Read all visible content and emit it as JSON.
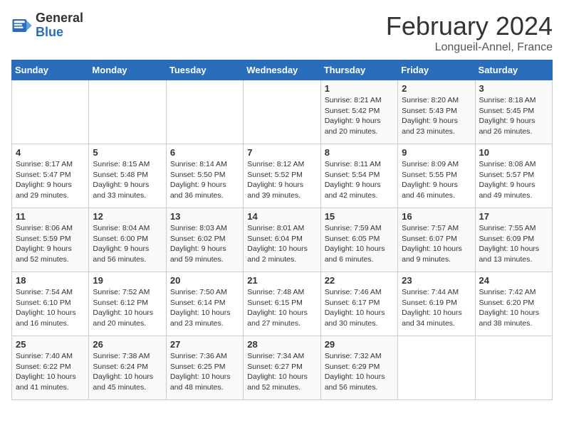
{
  "header": {
    "logo_general": "General",
    "logo_blue": "Blue",
    "title": "February 2024",
    "subtitle": "Longueil-Annel, France"
  },
  "weekdays": [
    "Sunday",
    "Monday",
    "Tuesday",
    "Wednesday",
    "Thursday",
    "Friday",
    "Saturday"
  ],
  "weeks": [
    [
      {
        "day": "",
        "info": ""
      },
      {
        "day": "",
        "info": ""
      },
      {
        "day": "",
        "info": ""
      },
      {
        "day": "",
        "info": ""
      },
      {
        "day": "1",
        "info": "Sunrise: 8:21 AM\nSunset: 5:42 PM\nDaylight: 9 hours and 20 minutes."
      },
      {
        "day": "2",
        "info": "Sunrise: 8:20 AM\nSunset: 5:43 PM\nDaylight: 9 hours and 23 minutes."
      },
      {
        "day": "3",
        "info": "Sunrise: 8:18 AM\nSunset: 5:45 PM\nDaylight: 9 hours and 26 minutes."
      }
    ],
    [
      {
        "day": "4",
        "info": "Sunrise: 8:17 AM\nSunset: 5:47 PM\nDaylight: 9 hours and 29 minutes."
      },
      {
        "day": "5",
        "info": "Sunrise: 8:15 AM\nSunset: 5:48 PM\nDaylight: 9 hours and 33 minutes."
      },
      {
        "day": "6",
        "info": "Sunrise: 8:14 AM\nSunset: 5:50 PM\nDaylight: 9 hours and 36 minutes."
      },
      {
        "day": "7",
        "info": "Sunrise: 8:12 AM\nSunset: 5:52 PM\nDaylight: 9 hours and 39 minutes."
      },
      {
        "day": "8",
        "info": "Sunrise: 8:11 AM\nSunset: 5:54 PM\nDaylight: 9 hours and 42 minutes."
      },
      {
        "day": "9",
        "info": "Sunrise: 8:09 AM\nSunset: 5:55 PM\nDaylight: 9 hours and 46 minutes."
      },
      {
        "day": "10",
        "info": "Sunrise: 8:08 AM\nSunset: 5:57 PM\nDaylight: 9 hours and 49 minutes."
      }
    ],
    [
      {
        "day": "11",
        "info": "Sunrise: 8:06 AM\nSunset: 5:59 PM\nDaylight: 9 hours and 52 minutes."
      },
      {
        "day": "12",
        "info": "Sunrise: 8:04 AM\nSunset: 6:00 PM\nDaylight: 9 hours and 56 minutes."
      },
      {
        "day": "13",
        "info": "Sunrise: 8:03 AM\nSunset: 6:02 PM\nDaylight: 9 hours and 59 minutes."
      },
      {
        "day": "14",
        "info": "Sunrise: 8:01 AM\nSunset: 6:04 PM\nDaylight: 10 hours and 2 minutes."
      },
      {
        "day": "15",
        "info": "Sunrise: 7:59 AM\nSunset: 6:05 PM\nDaylight: 10 hours and 6 minutes."
      },
      {
        "day": "16",
        "info": "Sunrise: 7:57 AM\nSunset: 6:07 PM\nDaylight: 10 hours and 9 minutes."
      },
      {
        "day": "17",
        "info": "Sunrise: 7:55 AM\nSunset: 6:09 PM\nDaylight: 10 hours and 13 minutes."
      }
    ],
    [
      {
        "day": "18",
        "info": "Sunrise: 7:54 AM\nSunset: 6:10 PM\nDaylight: 10 hours and 16 minutes."
      },
      {
        "day": "19",
        "info": "Sunrise: 7:52 AM\nSunset: 6:12 PM\nDaylight: 10 hours and 20 minutes."
      },
      {
        "day": "20",
        "info": "Sunrise: 7:50 AM\nSunset: 6:14 PM\nDaylight: 10 hours and 23 minutes."
      },
      {
        "day": "21",
        "info": "Sunrise: 7:48 AM\nSunset: 6:15 PM\nDaylight: 10 hours and 27 minutes."
      },
      {
        "day": "22",
        "info": "Sunrise: 7:46 AM\nSunset: 6:17 PM\nDaylight: 10 hours and 30 minutes."
      },
      {
        "day": "23",
        "info": "Sunrise: 7:44 AM\nSunset: 6:19 PM\nDaylight: 10 hours and 34 minutes."
      },
      {
        "day": "24",
        "info": "Sunrise: 7:42 AM\nSunset: 6:20 PM\nDaylight: 10 hours and 38 minutes."
      }
    ],
    [
      {
        "day": "25",
        "info": "Sunrise: 7:40 AM\nSunset: 6:22 PM\nDaylight: 10 hours and 41 minutes."
      },
      {
        "day": "26",
        "info": "Sunrise: 7:38 AM\nSunset: 6:24 PM\nDaylight: 10 hours and 45 minutes."
      },
      {
        "day": "27",
        "info": "Sunrise: 7:36 AM\nSunset: 6:25 PM\nDaylight: 10 hours and 48 minutes."
      },
      {
        "day": "28",
        "info": "Sunrise: 7:34 AM\nSunset: 6:27 PM\nDaylight: 10 hours and 52 minutes."
      },
      {
        "day": "29",
        "info": "Sunrise: 7:32 AM\nSunset: 6:29 PM\nDaylight: 10 hours and 56 minutes."
      },
      {
        "day": "",
        "info": ""
      },
      {
        "day": "",
        "info": ""
      }
    ]
  ]
}
